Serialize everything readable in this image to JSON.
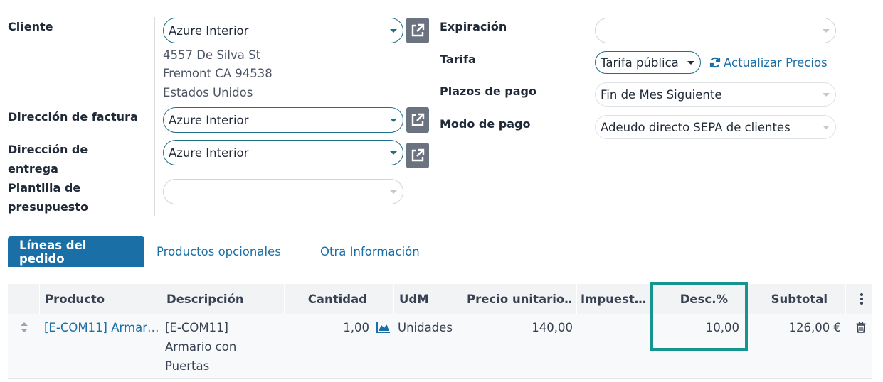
{
  "form": {
    "cliente": {
      "label": "Cliente",
      "value": "Azure Interior",
      "address": [
        "4557 De Silva St",
        "Fremont CA 94538",
        "Estados Unidos"
      ]
    },
    "direccion_factura": {
      "label": "Dirección de factura",
      "value": "Azure Interior"
    },
    "direccion_entrega": {
      "label_line1": "Dirección de",
      "label_line2": "entrega",
      "value": "Azure Interior"
    },
    "plantilla": {
      "label_line1": "Plantilla de",
      "label_line2": "presupuesto",
      "value": ""
    },
    "expiracion": {
      "label": "Expiración",
      "value": ""
    },
    "tarifa": {
      "label": "Tarifa",
      "value": "Tarifa pública",
      "update_label": "Actualizar Precios"
    },
    "plazos": {
      "label": "Plazos de pago",
      "value": "Fin de Mes Siguiente"
    },
    "modo_pago": {
      "label": "Modo de pago",
      "value": "Adeudo directo SEPA de clientes"
    }
  },
  "tabs": [
    "Líneas del pedido",
    "Productos opcionales",
    "Otra Información"
  ],
  "table": {
    "headers": {
      "producto": "Producto",
      "descripcion": "Descripción",
      "cantidad": "Cantidad",
      "udm": "UdM",
      "precio": "Precio unitario…",
      "impuestos": "Impuest…",
      "desc": "Desc.%",
      "subtotal": "Subtotal"
    },
    "row": {
      "producto": "[E-COM11] Armar…",
      "descripcion": [
        "[E-COM11]",
        "Armario con",
        "Puertas"
      ],
      "cantidad": "1,00",
      "udm": "Unidades",
      "precio": "140,00",
      "desc": "10,00",
      "subtotal": "126,00 €"
    }
  },
  "icons": {
    "external": "external-link-icon",
    "refresh": "refresh-icon",
    "forecast": "area-chart-icon",
    "delete": "trash-icon",
    "drag": "drag-handle-icon",
    "options": "kebab-menu-icon"
  },
  "colors": {
    "primary": "#1a6fa6",
    "highlight": "#159590"
  }
}
